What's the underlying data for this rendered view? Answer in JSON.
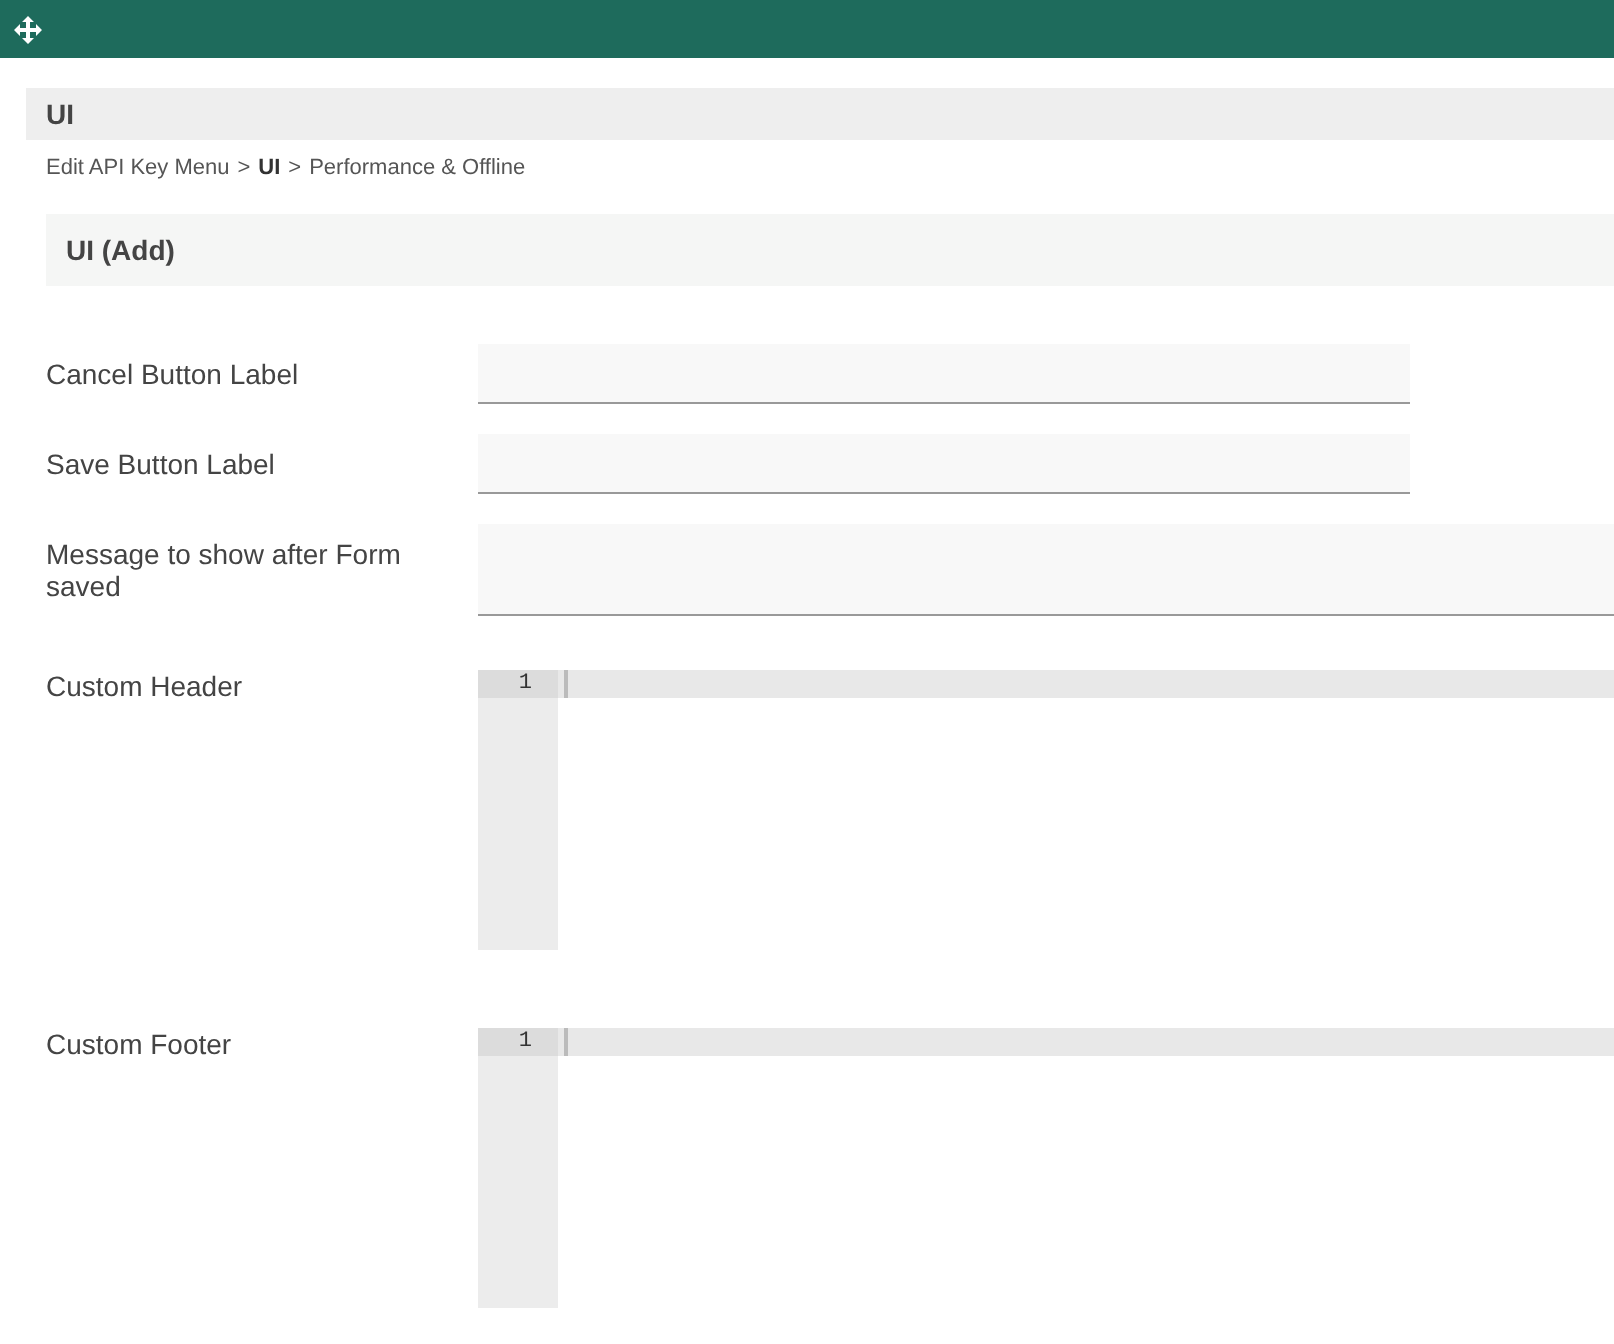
{
  "page_title": "UI",
  "breadcrumb": [
    {
      "kind": "link",
      "text": "Edit API Key Menu"
    },
    {
      "kind": "sep",
      "text": ">"
    },
    {
      "kind": "current",
      "text": "UI"
    },
    {
      "kind": "sep",
      "text": ">"
    },
    {
      "kind": "link",
      "text": "Performance & Offline"
    }
  ],
  "section_title": "UI (Add)",
  "fields": [
    {
      "kind": "input",
      "label": "Cancel Button Label"
    },
    {
      "kind": "input",
      "label": "Save Button Label"
    },
    {
      "kind": "textarea",
      "label": "Message to show after Form saved"
    },
    {
      "kind": "code",
      "label": "Custom Header",
      "line_numbers": [
        "1"
      ]
    },
    {
      "kind": "code",
      "label": "Custom Footer",
      "line_numbers": [
        "1"
      ]
    }
  ]
}
